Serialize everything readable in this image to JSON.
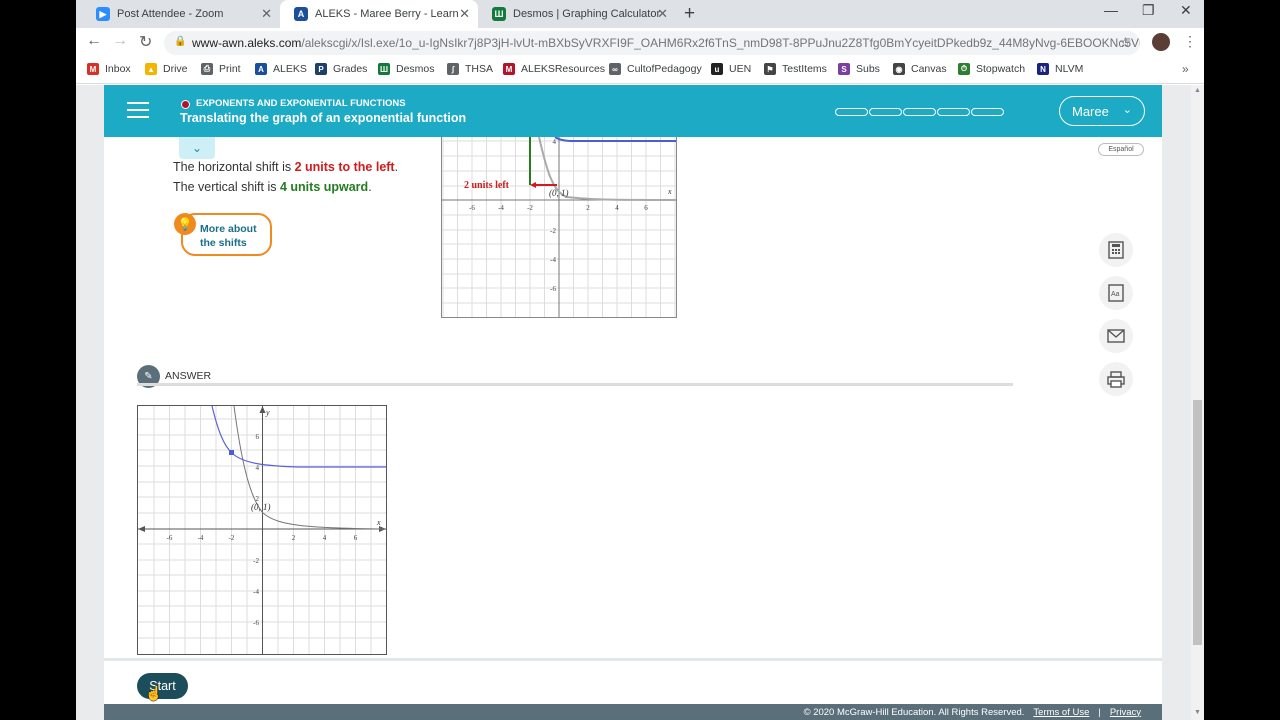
{
  "browser": {
    "tabs": [
      {
        "title": "Post Attendee - Zoom",
        "icon": "zoom-icon",
        "color": "#2d8cff",
        "active": false
      },
      {
        "title": "ALEKS - Maree Berry - Learn",
        "icon": "aleks-icon",
        "color": "#1b4f9c",
        "active": true
      },
      {
        "title": "Desmos | Graphing Calculator",
        "icon": "desmos-icon",
        "color": "#127a3a",
        "active": false
      }
    ],
    "url_host": "www-awn.aleks.com",
    "url_path": "/alekscgi/x/Isl.exe/1o_u-IgNsIkr7j8P3jH-lvUt-mBXbSyVRXFI9F_OAHM6Rx2f6TnS_nmD98T-8PPuJnu2Z8Tfg0BmYcyeitDPkedb9z_44M8yNvg-6EBOOKNc5Vpredq...",
    "bookmarks": [
      {
        "label": "Inbox",
        "color": "#d93025"
      },
      {
        "label": "Drive",
        "color": "#f4b400"
      },
      {
        "label": "Print",
        "color": "#5f6368"
      },
      {
        "label": "ALEKS",
        "color": "#1b4f9c"
      },
      {
        "label": "Grades",
        "color": "#1c3f6e"
      },
      {
        "label": "Desmos",
        "color": "#127a3a"
      },
      {
        "label": "THSA",
        "color": "#5f6368"
      },
      {
        "label": "ALEKSResources",
        "color": "#b3142b"
      },
      {
        "label": "CultofPedagogy",
        "color": "#5f6368"
      },
      {
        "label": "UEN",
        "color": "#222222"
      },
      {
        "label": "TestItems",
        "color": "#444444"
      },
      {
        "label": "Subs",
        "color": "#7b3fa0"
      },
      {
        "label": "Canvas",
        "color": "#444444"
      },
      {
        "label": "Stopwatch",
        "color": "#2e7d32"
      },
      {
        "label": "NLVM",
        "color": "#1a237e"
      }
    ]
  },
  "header": {
    "topic": "EXPONENTS AND EXPONENTIAL FUNCTIONS",
    "lesson": "Translating the graph of an exponential function",
    "user": "Maree",
    "progress_segments": 5,
    "color": "#1daac4"
  },
  "explanation": {
    "horizontal_prefix": "The horizontal shift is ",
    "horizontal_value": "2 units to the left",
    "vertical_prefix": "The vertical shift is ",
    "vertical_value": "4 units upward",
    "period": ".",
    "more_line1": "More about",
    "more_line2": "the shifts",
    "espanol": "Español"
  },
  "top_graph": {
    "label_units_left": "2 units left",
    "point_label": "(0, 1)",
    "x_axis_label": "x",
    "x_ticks": [
      "-6",
      "-4",
      "-2",
      "2",
      "4",
      "6"
    ],
    "y_ticks": [
      "4",
      "-2",
      "-4",
      "-6"
    ]
  },
  "answer": {
    "label": "ANSWER",
    "point_label": "(0, 1)",
    "x_axis_label": "x",
    "y_axis_label": "y",
    "x_ticks": [
      "-6",
      "-4",
      "-2",
      "2",
      "4",
      "6"
    ],
    "y_ticks": [
      "6",
      "4",
      "2",
      "-2",
      "-4",
      "-6"
    ]
  },
  "footer": {
    "start": "Start",
    "copyright": "© 2020 McGraw-Hill Education. All Rights Reserved.",
    "terms": "Terms of Use",
    "separator": "|",
    "privacy": "Privacy"
  }
}
